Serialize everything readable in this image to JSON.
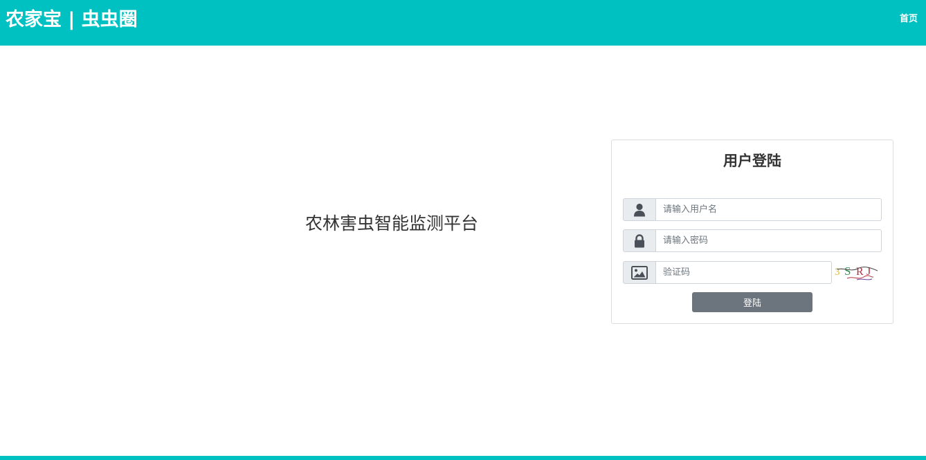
{
  "header": {
    "brand": "农家宝 | 虫虫圈",
    "nav_home": "首页"
  },
  "main": {
    "platform_title": "农林害虫智能监测平台"
  },
  "login": {
    "title": "用户登陆",
    "username": {
      "placeholder": "请输入用户名",
      "value": "",
      "icon": "user-icon"
    },
    "password": {
      "placeholder": "请输入密码",
      "value": "",
      "icon": "lock-icon"
    },
    "captcha": {
      "placeholder": "验证码",
      "value": "",
      "icon": "image-icon",
      "code": "3SRJ"
    },
    "submit_label": "登陆"
  },
  "colors": {
    "primary": "#00c1c1",
    "button": "#6c757d",
    "addon_bg": "#e9ecef",
    "border": "#ced4da"
  }
}
